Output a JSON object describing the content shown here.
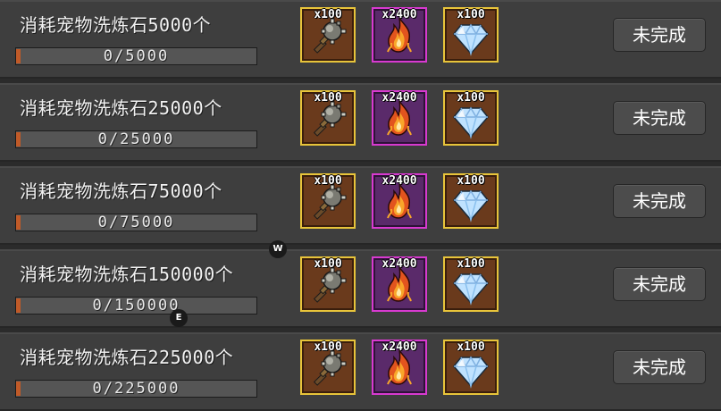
{
  "quests": [
    {
      "title": "消耗宠物洗炼石5000个",
      "progress_text": "0/5000",
      "progress": 0,
      "rewards": [
        {
          "qty": "x100",
          "icon": "mace-icon",
          "rarity": "gold"
        },
        {
          "qty": "x2400",
          "icon": "flame-icon",
          "rarity": "purple"
        },
        {
          "qty": "x100",
          "icon": "gem-icon",
          "rarity": "gold"
        }
      ],
      "status": "未完成"
    },
    {
      "title": "消耗宠物洗炼石25000个",
      "progress_text": "0/25000",
      "progress": 0,
      "rewards": [
        {
          "qty": "x100",
          "icon": "mace-icon",
          "rarity": "gold"
        },
        {
          "qty": "x2400",
          "icon": "flame-icon",
          "rarity": "purple"
        },
        {
          "qty": "x100",
          "icon": "gem-icon",
          "rarity": "gold"
        }
      ],
      "status": "未完成"
    },
    {
      "title": "消耗宠物洗炼石75000个",
      "progress_text": "0/75000",
      "progress": 0,
      "rewards": [
        {
          "qty": "x100",
          "icon": "mace-icon",
          "rarity": "gold"
        },
        {
          "qty": "x2400",
          "icon": "flame-icon",
          "rarity": "purple"
        },
        {
          "qty": "x100",
          "icon": "gem-icon",
          "rarity": "gold"
        }
      ],
      "status": "未完成"
    },
    {
      "title": "消耗宠物洗炼石150000个",
      "progress_text": "0/150000",
      "progress": 0,
      "rewards": [
        {
          "qty": "x100",
          "icon": "mace-icon",
          "rarity": "gold"
        },
        {
          "qty": "x2400",
          "icon": "flame-icon",
          "rarity": "purple"
        },
        {
          "qty": "x100",
          "icon": "gem-icon",
          "rarity": "gold"
        }
      ],
      "status": "未完成"
    },
    {
      "title": "消耗宠物洗炼石225000个",
      "progress_text": "0/225000",
      "progress": 0,
      "rewards": [
        {
          "qty": "x100",
          "icon": "mace-icon",
          "rarity": "gold"
        },
        {
          "qty": "x2400",
          "icon": "flame-icon",
          "rarity": "purple"
        },
        {
          "qty": "x100",
          "icon": "gem-icon",
          "rarity": "gold"
        }
      ],
      "status": "未完成"
    }
  ],
  "hotkeys": {
    "w": "W",
    "e": "E"
  },
  "colors": {
    "progress_fill": "#c05a28",
    "frame_gold": "#e8c43a",
    "frame_purple": "#d83ad0"
  }
}
